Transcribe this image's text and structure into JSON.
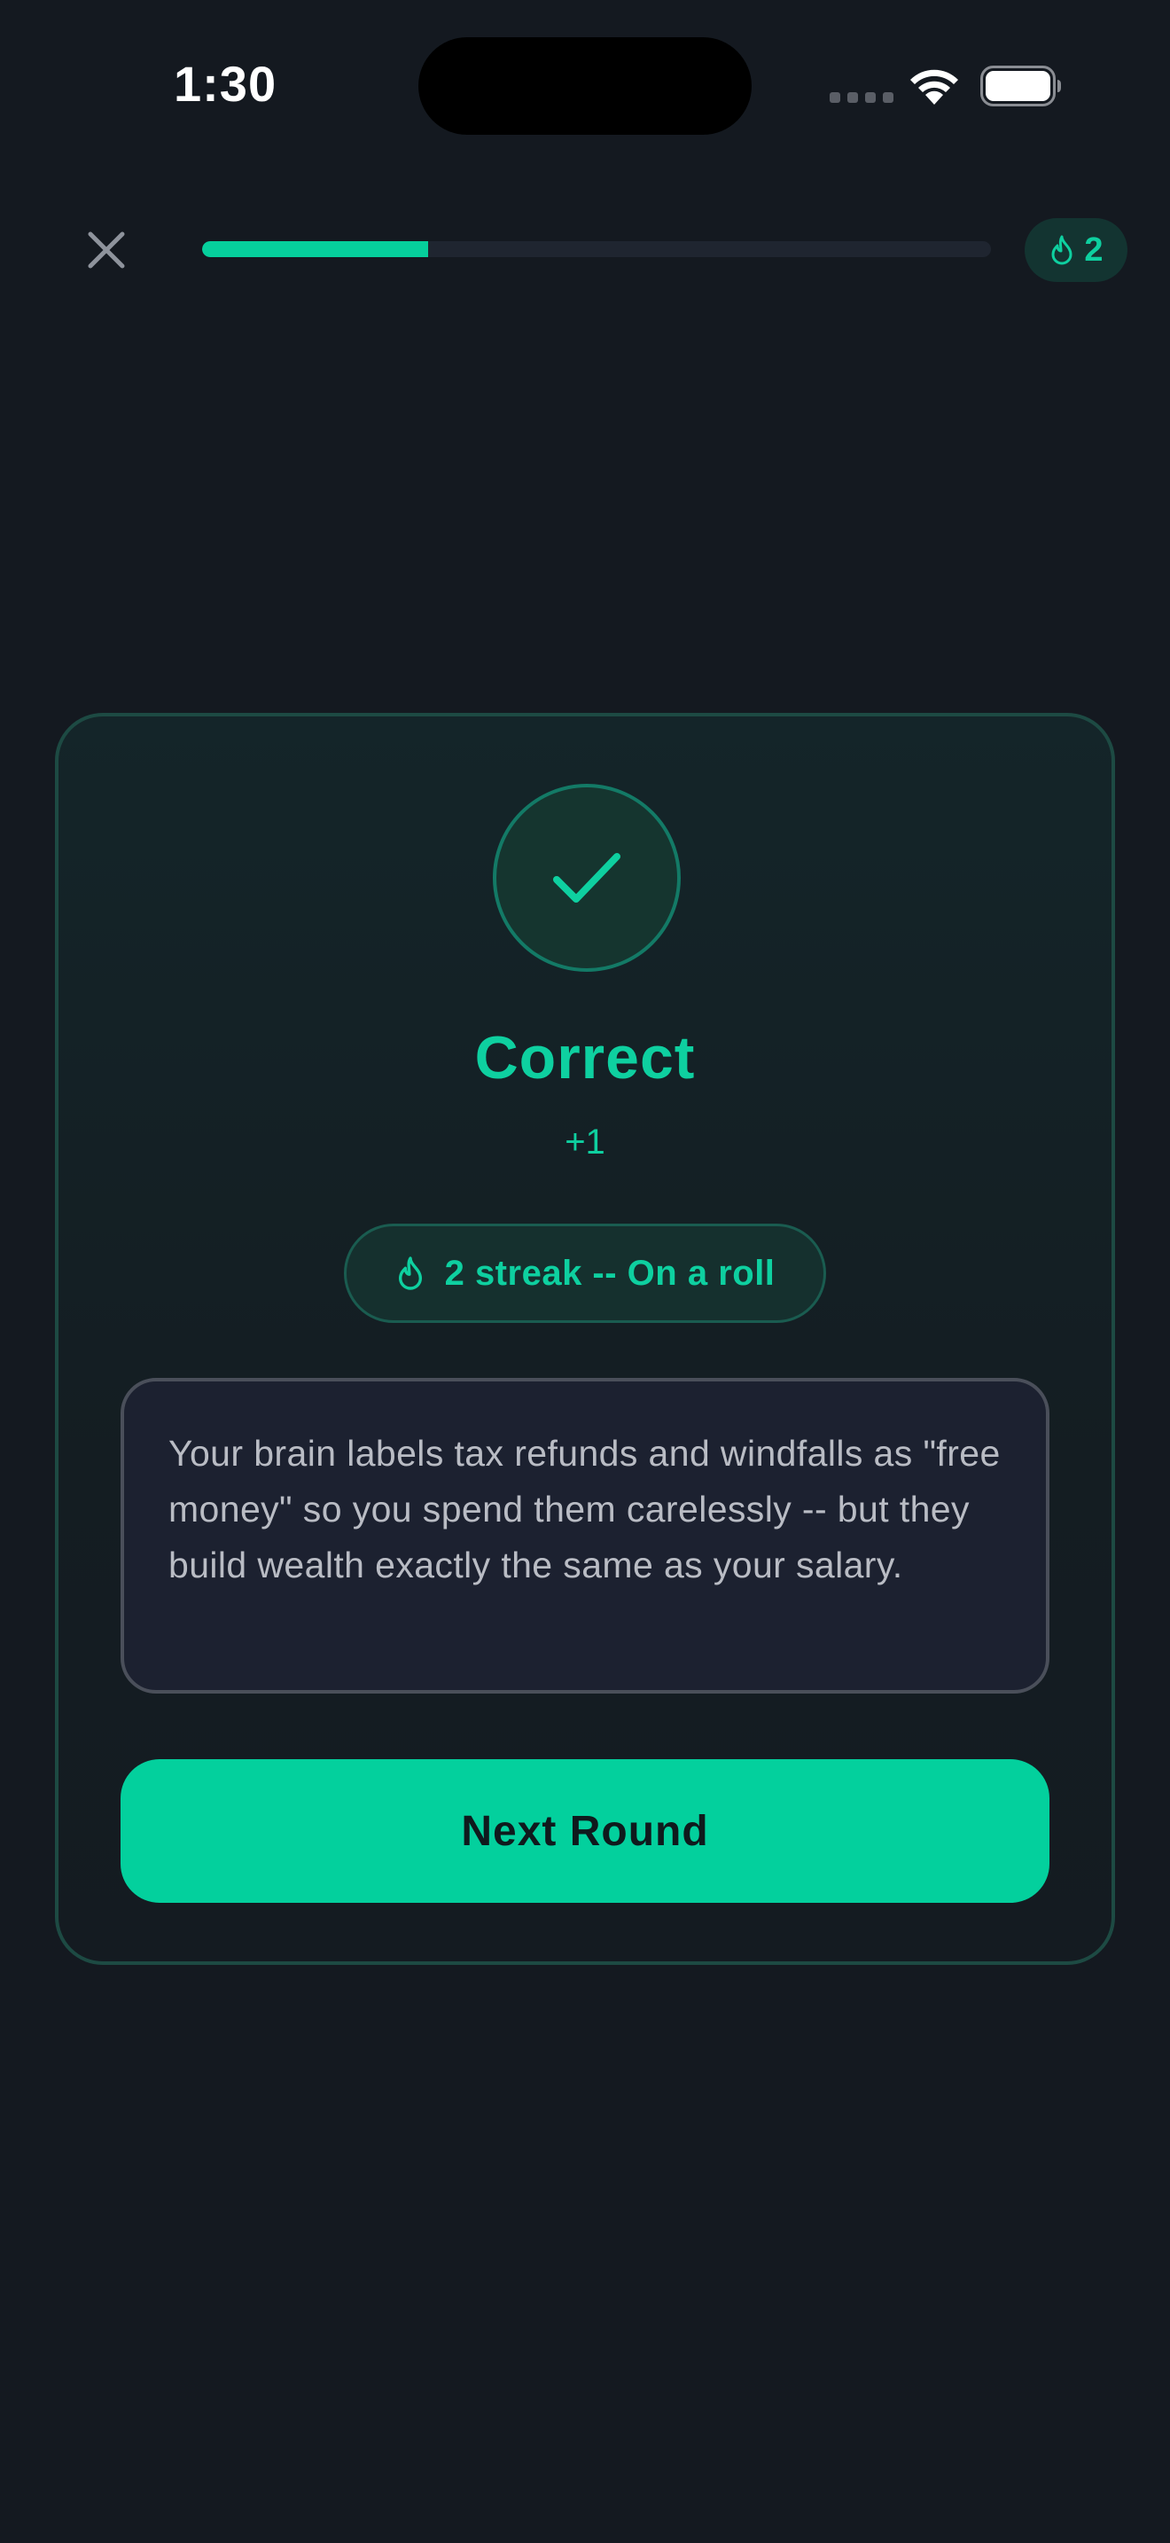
{
  "status_bar": {
    "time": "1:30"
  },
  "top_bar": {
    "close_icon": "close-icon",
    "progress_fraction": 0.286,
    "streak_count": "2",
    "streak_icon": "flame-icon"
  },
  "result": {
    "icon": "checkmark-icon",
    "title": "Correct",
    "points": "+1",
    "streak_badge": "2 streak -- On a roll",
    "explanation": "Your brain labels tax refunds and windfalls as \"free money\" so you spend them carelessly -- but they build wealth exactly the same as your salary.",
    "next_button": "Next Round"
  },
  "colors": {
    "background": "#141920",
    "accent": "#06cf9c",
    "card_border": "#1d4a43",
    "explanation_bg": "#1c2130",
    "explanation_text": "#b9bcc4"
  }
}
